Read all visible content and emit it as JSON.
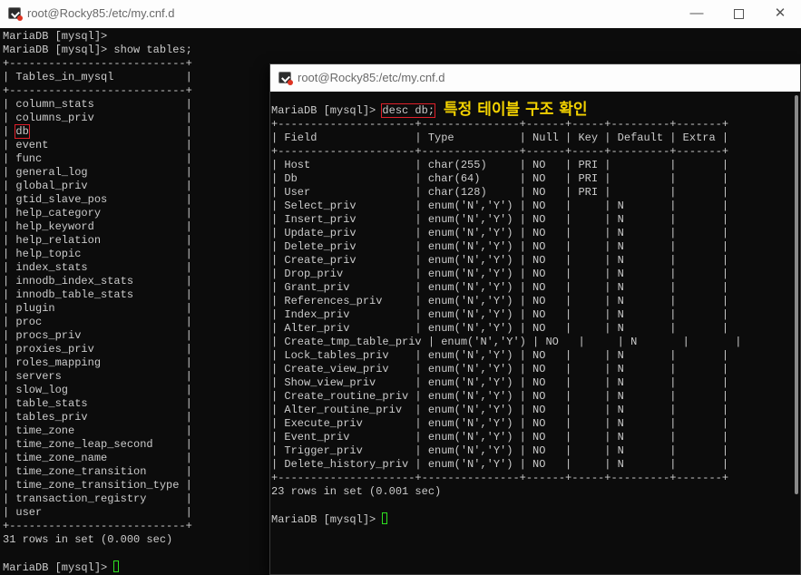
{
  "window1": {
    "title": "root@Rocky85:/etc/my.cnf.d",
    "controls": {
      "minimize": "—",
      "close": "✕"
    },
    "lines": [
      {
        "t": "MariaDB [mysql]>"
      },
      {
        "t": "MariaDB [mysql]> show tables;"
      },
      {
        "t": "+---------------------------+"
      },
      {
        "t": "| Tables_in_mysql           |"
      },
      {
        "t": "+---------------------------+"
      },
      {
        "t": "| column_stats              |"
      },
      {
        "t": "| columns_priv              |"
      },
      {
        "t": "| ",
        "h": "db",
        "a": "                        |"
      },
      {
        "t": "| event                     |"
      },
      {
        "t": "| func                      |"
      },
      {
        "t": "| general_log               |"
      },
      {
        "t": "| global_priv               |"
      },
      {
        "t": "| gtid_slave_pos            |"
      },
      {
        "t": "| help_category             |"
      },
      {
        "t": "| help_keyword              |"
      },
      {
        "t": "| help_relation             |"
      },
      {
        "t": "| help_topic                |"
      },
      {
        "t": "| index_stats               |"
      },
      {
        "t": "| innodb_index_stats        |"
      },
      {
        "t": "| innodb_table_stats        |"
      },
      {
        "t": "| plugin                    |"
      },
      {
        "t": "| proc                      |"
      },
      {
        "t": "| procs_priv                |"
      },
      {
        "t": "| proxies_priv              |"
      },
      {
        "t": "| roles_mapping             |"
      },
      {
        "t": "| servers                   |"
      },
      {
        "t": "| slow_log                  |"
      },
      {
        "t": "| table_stats               |"
      },
      {
        "t": "| tables_priv               |"
      },
      {
        "t": "| time_zone                 |"
      },
      {
        "t": "| time_zone_leap_second     |"
      },
      {
        "t": "| time_zone_name            |"
      },
      {
        "t": "| time_zone_transition      |"
      },
      {
        "t": "| time_zone_transition_type |"
      },
      {
        "t": "| transaction_registry      |"
      },
      {
        "t": "| user                      |"
      },
      {
        "t": "+---------------------------+"
      },
      {
        "t": "31 rows in set (0.000 sec)"
      },
      {
        "t": ""
      },
      {
        "t": "MariaDB [mysql]> ",
        "cursor": true
      }
    ]
  },
  "window2": {
    "title": "root@Rocky85:/etc/my.cnf.d",
    "lines": [
      {
        "t": "MariaDB [mysql]> ",
        "h": "desc db;",
        "note": "특정 테이블 구조 확인"
      },
      {
        "t": "+---------------------+---------------+------+-----+---------+-------+"
      },
      {
        "t": "| Field               | Type          | Null | Key | Default | Extra |"
      },
      {
        "t": "+---------------------+---------------+------+-----+---------+-------+"
      },
      {
        "t": "| Host                | char(255)     | NO   | PRI |         |       |"
      },
      {
        "t": "| Db                  | char(64)      | NO   | PRI |         |       |"
      },
      {
        "t": "| User                | char(128)     | NO   | PRI |         |       |"
      },
      {
        "t": "| Select_priv         | enum('N','Y') | NO   |     | N       |       |"
      },
      {
        "t": "| Insert_priv         | enum('N','Y') | NO   |     | N       |       |"
      },
      {
        "t": "| Update_priv         | enum('N','Y') | NO   |     | N       |       |"
      },
      {
        "t": "| Delete_priv         | enum('N','Y') | NO   |     | N       |       |"
      },
      {
        "t": "| Create_priv         | enum('N','Y') | NO   |     | N       |       |"
      },
      {
        "t": "| Drop_priv           | enum('N','Y') | NO   |     | N       |       |"
      },
      {
        "t": "| Grant_priv          | enum('N','Y') | NO   |     | N       |       |"
      },
      {
        "t": "| References_priv     | enum('N','Y') | NO   |     | N       |       |"
      },
      {
        "t": "| Index_priv          | enum('N','Y') | NO   |     | N       |       |"
      },
      {
        "t": "| Alter_priv          | enum('N','Y') | NO   |     | N       |       |"
      },
      {
        "t": "| Create_tmp_table_priv | enum('N','Y') | NO   |     | N       |       |"
      },
      {
        "t": "| Lock_tables_priv    | enum('N','Y') | NO   |     | N       |       |"
      },
      {
        "t": "| Create_view_priv    | enum('N','Y') | NO   |     | N       |       |"
      },
      {
        "t": "| Show_view_priv      | enum('N','Y') | NO   |     | N       |       |"
      },
      {
        "t": "| Create_routine_priv | enum('N','Y') | NO   |     | N       |       |"
      },
      {
        "t": "| Alter_routine_priv  | enum('N','Y') | NO   |     | N       |       |"
      },
      {
        "t": "| Execute_priv        | enum('N','Y') | NO   |     | N       |       |"
      },
      {
        "t": "| Event_priv          | enum('N','Y') | NO   |     | N       |       |"
      },
      {
        "t": "| Trigger_priv        | enum('N','Y') | NO   |     | N       |       |"
      },
      {
        "t": "| Delete_history_priv | enum('N','Y') | NO   |     | N       |       |"
      },
      {
        "t": "+---------------------+---------------+------+-----+---------+-------+"
      },
      {
        "t": "23 rows in set (0.001 sec)"
      },
      {
        "t": ""
      },
      {
        "t": "MariaDB [mysql]> ",
        "cursor": true
      }
    ]
  },
  "colors": {
    "terminal_bg": "#0c0c0c",
    "text": "#cccccc",
    "highlight_box": "#e0202a",
    "annotation": "#f3d200",
    "cursor": "#2ee020"
  }
}
